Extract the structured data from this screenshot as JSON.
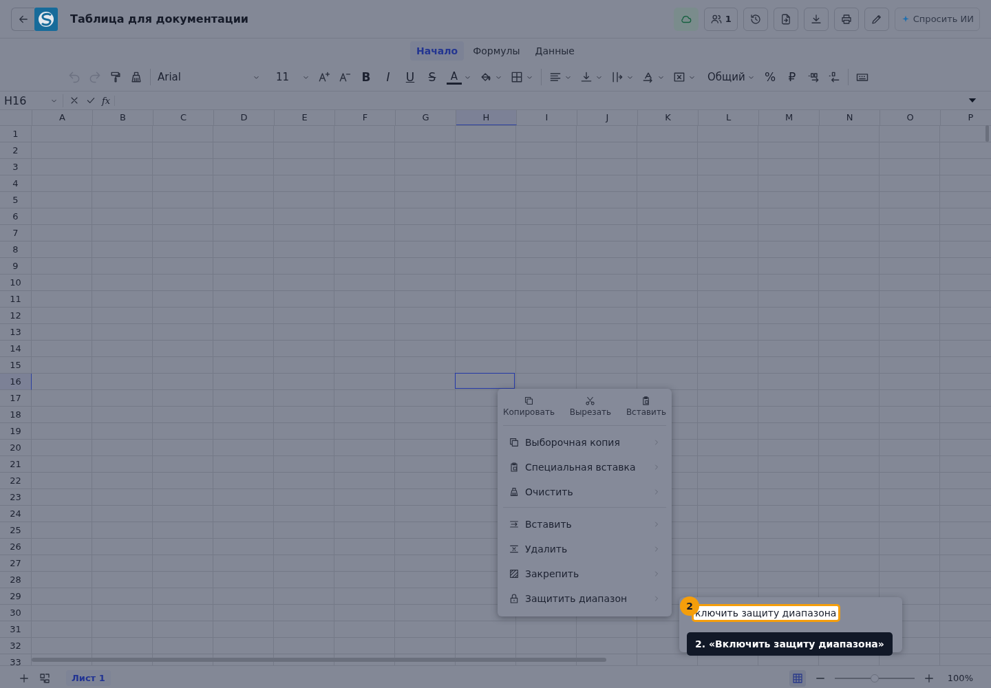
{
  "app": {
    "title": "Таблица для документации",
    "collaborators": "1",
    "ask_ai": "Спросить ИИ"
  },
  "ribbon_tabs": [
    {
      "label": "Начало",
      "selected": true
    },
    {
      "label": "Формулы",
      "selected": false
    },
    {
      "label": "Данные",
      "selected": false
    }
  ],
  "toolbar": {
    "undo": {
      "disabled": true
    },
    "redo": {
      "disabled": true
    },
    "font": "Arial",
    "font_size": "11",
    "format_buttons": [
      {
        "label": "B",
        "kind": "bold"
      },
      {
        "label": "I",
        "kind": "italic"
      },
      {
        "label": "U",
        "kind": "underline"
      },
      {
        "label": "S",
        "kind": "strike"
      }
    ],
    "text_color": "A",
    "number_format": "Общий",
    "percent": "%",
    "currency": "₽"
  },
  "formula_bar": {
    "cell_ref": "H16",
    "function_label": "fx"
  },
  "sheet": {
    "columns": [
      {
        "label": "A",
        "selected": false
      },
      {
        "label": "B",
        "selected": false
      },
      {
        "label": "C",
        "selected": false
      },
      {
        "label": "D",
        "selected": false
      },
      {
        "label": "E",
        "selected": false
      },
      {
        "label": "F",
        "selected": false
      },
      {
        "label": "G",
        "selected": false
      },
      {
        "label": "H",
        "selected": true
      },
      {
        "label": "I",
        "selected": false
      },
      {
        "label": "J",
        "selected": false
      },
      {
        "label": "K",
        "selected": false
      },
      {
        "label": "L",
        "selected": false
      },
      {
        "label": "M",
        "selected": false
      },
      {
        "label": "N",
        "selected": false
      },
      {
        "label": "O",
        "selected": false
      },
      {
        "label": "P",
        "selected": false
      }
    ],
    "rows": [
      {
        "label": "1",
        "selected": false
      },
      {
        "label": "2",
        "selected": false
      },
      {
        "label": "3",
        "selected": false
      },
      {
        "label": "4",
        "selected": false
      },
      {
        "label": "5",
        "selected": false
      },
      {
        "label": "6",
        "selected": false
      },
      {
        "label": "7",
        "selected": false
      },
      {
        "label": "8",
        "selected": false
      },
      {
        "label": "9",
        "selected": false
      },
      {
        "label": "10",
        "selected": false
      },
      {
        "label": "11",
        "selected": false
      },
      {
        "label": "12",
        "selected": false
      },
      {
        "label": "13",
        "selected": false
      },
      {
        "label": "14",
        "selected": false
      },
      {
        "label": "15",
        "selected": false
      },
      {
        "label": "16",
        "selected": true
      },
      {
        "label": "17",
        "selected": false
      },
      {
        "label": "18",
        "selected": false
      },
      {
        "label": "19",
        "selected": false
      },
      {
        "label": "20",
        "selected": false
      },
      {
        "label": "21",
        "selected": false
      },
      {
        "label": "22",
        "selected": false
      },
      {
        "label": "23",
        "selected": false
      },
      {
        "label": "24",
        "selected": false
      },
      {
        "label": "25",
        "selected": false
      },
      {
        "label": "26",
        "selected": false
      },
      {
        "label": "27",
        "selected": false
      },
      {
        "label": "28",
        "selected": false
      },
      {
        "label": "29",
        "selected": false
      },
      {
        "label": "30",
        "selected": false
      },
      {
        "label": "31",
        "selected": false
      },
      {
        "label": "32",
        "selected": false
      },
      {
        "label": "33",
        "selected": false
      }
    ]
  },
  "context_menu": {
    "quick_actions": [
      {
        "label": "Копировать"
      },
      {
        "label": "Вырезать"
      },
      {
        "label": "Вставить"
      }
    ],
    "groups": [
      [
        {
          "label": "Выборочная копия",
          "submenu": true
        },
        {
          "label": "Специальная вставка",
          "submenu": true
        },
        {
          "label": "Очистить",
          "submenu": true
        }
      ],
      [
        {
          "label": "Вставить",
          "submenu": true
        },
        {
          "label": "Удалить",
          "submenu": true
        },
        {
          "label": "Закрепить",
          "submenu": true
        },
        {
          "label": "Защитить диапазон",
          "submenu": true
        }
      ]
    ]
  },
  "submenu": {
    "items": [
      {
        "label": "ключить защиту диапазона",
        "highlighted": true
      }
    ]
  },
  "tutorial": {
    "step_badge": "2",
    "tooltip": "2. «Включить защиту диапазона»"
  },
  "status_bar": {
    "sheets": [
      {
        "label": "Лист 1",
        "selected": true
      }
    ],
    "zoom": {
      "level": 0.5,
      "reading": "100%"
    }
  }
}
